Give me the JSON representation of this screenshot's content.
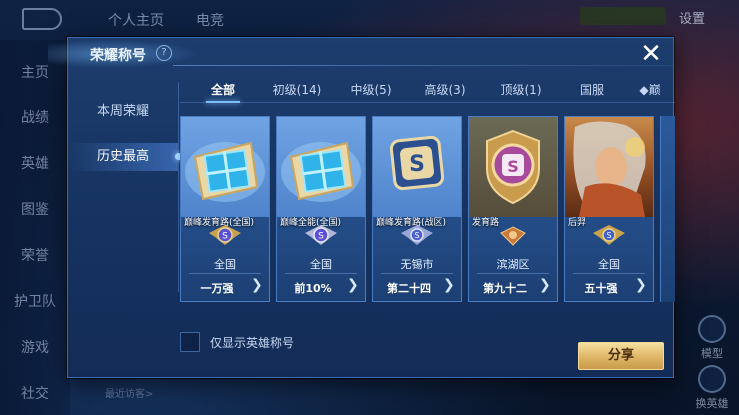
{
  "background": {
    "top_tabs": [
      "个人主页",
      "电竞"
    ],
    "settings_label": "设置",
    "left_nav": [
      "主页",
      "战绩",
      "英雄",
      "图鉴",
      "荣誉",
      "护卫队",
      "游戏",
      "社交"
    ],
    "recent_visitors": "最近访客>",
    "right_icons": [
      "模型",
      "换英雄"
    ]
  },
  "modal": {
    "title": "荣耀称号",
    "help_icon": "?",
    "close_icon": "✕",
    "subnav": [
      "本周荣耀",
      "历史最高"
    ],
    "active_subnav": "历史最高",
    "tabs": [
      "全部",
      "初级(14)",
      "中级(5)",
      "高级(3)",
      "顶级(1)",
      "国服",
      "巅"
    ],
    "active_tab": "全部",
    "cards": [
      {
        "art": "blue-gift",
        "title": "巅峰发育路(全国)",
        "region": "全国",
        "rank": "一万强"
      },
      {
        "art": "blue-gift",
        "title": "巅峰全能(全国)",
        "region": "全国",
        "rank": "前10%"
      },
      {
        "art": "logo-s",
        "title": "巅峰发育路(战区)",
        "region": "无锡市",
        "rank": "第二十四"
      },
      {
        "art": "shield-s",
        "title": "发育路",
        "region": "滨湖区",
        "rank": "第九十二"
      },
      {
        "art": "hero",
        "title": "后羿",
        "region": "全国",
        "rank": "五十强"
      }
    ],
    "checkbox_label": "仅显示英雄称号",
    "share_label": "分享",
    "colors": {
      "accent": "#7fc1ff",
      "share_button": "#e0b96a",
      "panel": "#163361"
    }
  }
}
